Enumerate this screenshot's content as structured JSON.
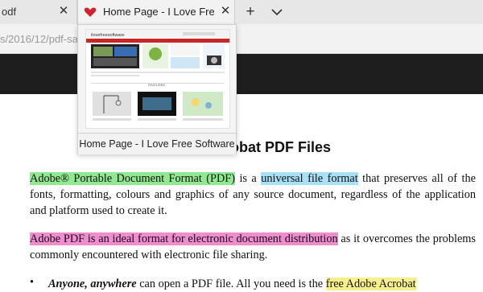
{
  "tabs": {
    "inactive": {
      "title": "odf"
    },
    "active": {
      "title": "Home Page - I Love Free Software"
    }
  },
  "addressbar": {
    "url": "s/2016/12/pdf-sa"
  },
  "preview": {
    "caption": "Home Page - I Love Free Software",
    "thumbnail": {
      "logo": "ilovefreesoftware",
      "section_heading": "FEATURED"
    }
  },
  "document": {
    "title": "Acrobat PDF Files",
    "para1": {
      "hl1": "Adobe® Portable Document Format (PDF)",
      "t1": " is a ",
      "hl2": "universal file format",
      "t2": " that preserves all of the fonts, formatting, colours and graphics of any source document, regardless of the application and platform used to create it."
    },
    "para2": {
      "hl1": "Adobe PDF is an ideal format for electronic document distribution",
      "t1": " as it overcomes the problems commonly encountered with electronic file sharing."
    },
    "bullet1": {
      "bullet": "•",
      "em": "Anyone, anywhere",
      "t1": " can open a PDF file. All you need is the ",
      "hl1": "free Adobe Acrobat"
    }
  },
  "colors": {
    "highlight_green": "#90e890",
    "highlight_blue": "#a8e0f8",
    "highlight_pink": "#f08cd0",
    "highlight_yellow": "#f8f08c",
    "favicon_red": "#d2232a"
  },
  "icons": {
    "favicon": "heart-icon",
    "close": "close-icon",
    "new_tab": "plus-icon",
    "tab_list": "chevron-down-icon"
  }
}
